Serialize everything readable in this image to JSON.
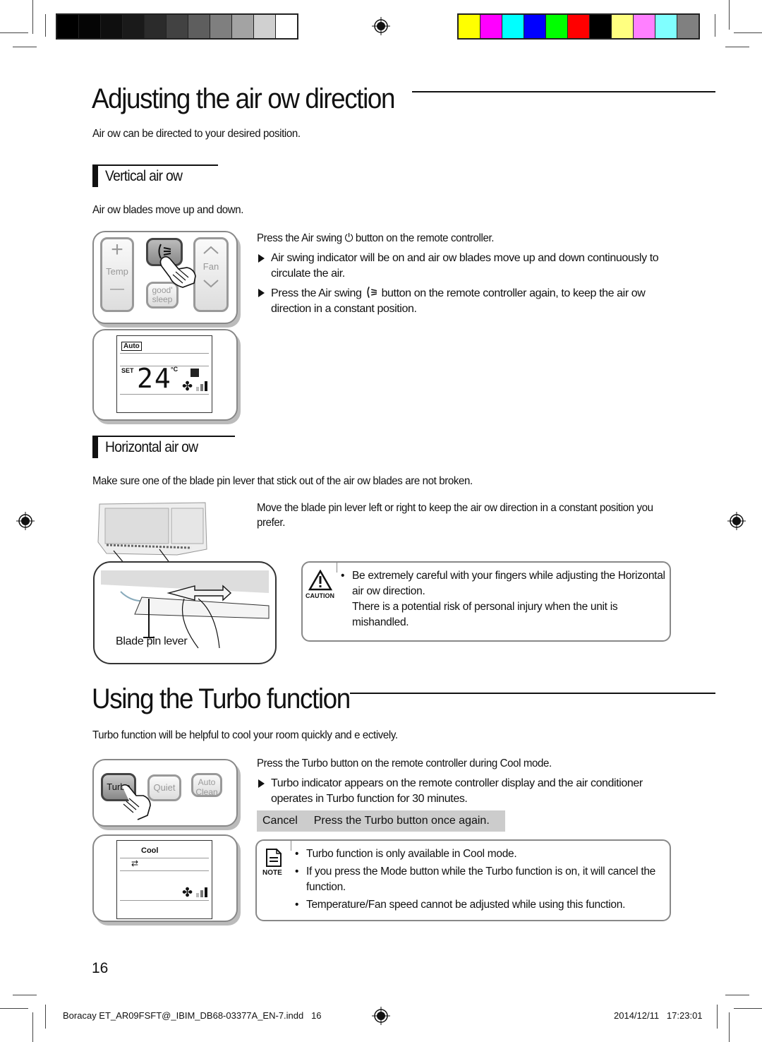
{
  "print_marks": {
    "grayscale_swatches": [
      "#000000",
      "#050505",
      "#0f0f0f",
      "#1a1a1a",
      "#2b2b2b",
      "#424242",
      "#5e5e5e",
      "#7f7f7f",
      "#a3a3a3",
      "#d0d0d0",
      "#ffffff"
    ],
    "color_swatches": [
      "#ffff00",
      "#ff00ff",
      "#00ffff",
      "#0000ff",
      "#00ff00",
      "#ff0000",
      "#000000",
      "#ffff80",
      "#ff80ff",
      "#80ffff",
      "#808080"
    ]
  },
  "section1": {
    "title": "Adjusting the air   ow direction",
    "intro": "Air  ow can be directed to your desired position.",
    "vertical": {
      "heading": "Vertical air   ow",
      "desc": "Air  ow blades move up and down.",
      "instruction_pre": "Press the Air swing",
      "instruction_post": "button on the remote controller.",
      "bullets": [
        "Air swing indicator will be on and air  ow blades move up and down continuously to circulate the air.",
        "button on the remote controller again, to keep the air  ow direction in a constant position."
      ],
      "bullet2_pre": "Press the Air swing",
      "remote": {
        "temp_label": "Temp",
        "fan_label": "Fan",
        "good_sleep_label": "good'\nsleep",
        "plus": "+",
        "minus": "—"
      },
      "display": {
        "mode": "Auto",
        "set_label": "SET",
        "temperature": "24",
        "unit": "°C"
      }
    },
    "horizontal": {
      "heading": "Horizontal air   ow",
      "desc": "Make sure one of the blade pin lever that stick out of the air  ow blades are not broken.",
      "instruction": "Move the blade pin lever left or right to keep the air   ow direction in a constant position you prefer.",
      "illustration_label": "Blade pin lever",
      "caution": {
        "icon_label": "CAUTION",
        "text_1": "Be extremely careful with your fingers while adjusting the Horizontal air  ow direction.",
        "text_2": "There is a potential risk of personal injury when the unit is mishandled."
      }
    }
  },
  "section2": {
    "title": "Using the Turbo function",
    "intro": "Turbo function will be helpful to cool your room quickly and e ectively.",
    "instruction": "Press the Turbo button on the remote controller during Cool mode.",
    "bullets": [
      "Turbo indicator appears on the remote controller display and the air conditioner operates in Turbo function for 30 minutes."
    ],
    "cancel_label": "Cancel",
    "cancel_text": "Press the Turbo button once again.",
    "remote": {
      "turbo_label": "Turbo",
      "quiet_label": "Quiet",
      "auto_clean_label": "Auto\nClean"
    },
    "display": {
      "mode": "Cool"
    },
    "note": {
      "icon_label": "NOTE",
      "items": [
        "Turbo function is only available in Cool mode.",
        "If you press the Mode button while the Turbo function is on, it will cancel the function.",
        "Temperature/Fan speed cannot be adjusted while using this function."
      ]
    }
  },
  "footer": {
    "page_number": "16",
    "file_info": "Boracay ET_AR09FSFT@_IBIM_DB68-03377A_EN-7.indd   16",
    "timestamp": "2014/12/11   17:23:01"
  }
}
